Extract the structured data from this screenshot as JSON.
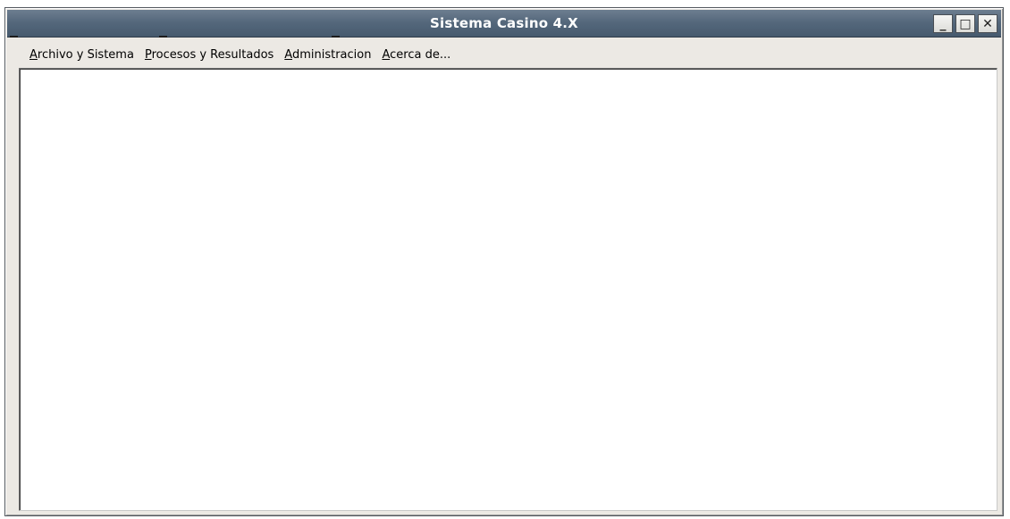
{
  "window": {
    "title": "Sistema Casino 4.X",
    "buttons": {
      "minimize": "_",
      "maximize": "□",
      "close": "✕"
    }
  },
  "menu": {
    "items": [
      {
        "accel": "A",
        "rest": "rchivo y Sistema",
        "label": "Archivo y Sistema"
      },
      {
        "accel": "P",
        "rest": "rocesos y Resultados",
        "label": "Procesos y Resultados"
      },
      {
        "accel": "A",
        "rest": "dministracion",
        "label": "Administracion"
      },
      {
        "accel": "A",
        "rest": "cerca de...",
        "label": "Acerca de..."
      }
    ]
  },
  "icons": {
    "minimize": "minimize-icon",
    "maximize": "maximize-icon",
    "close": "close-icon"
  }
}
